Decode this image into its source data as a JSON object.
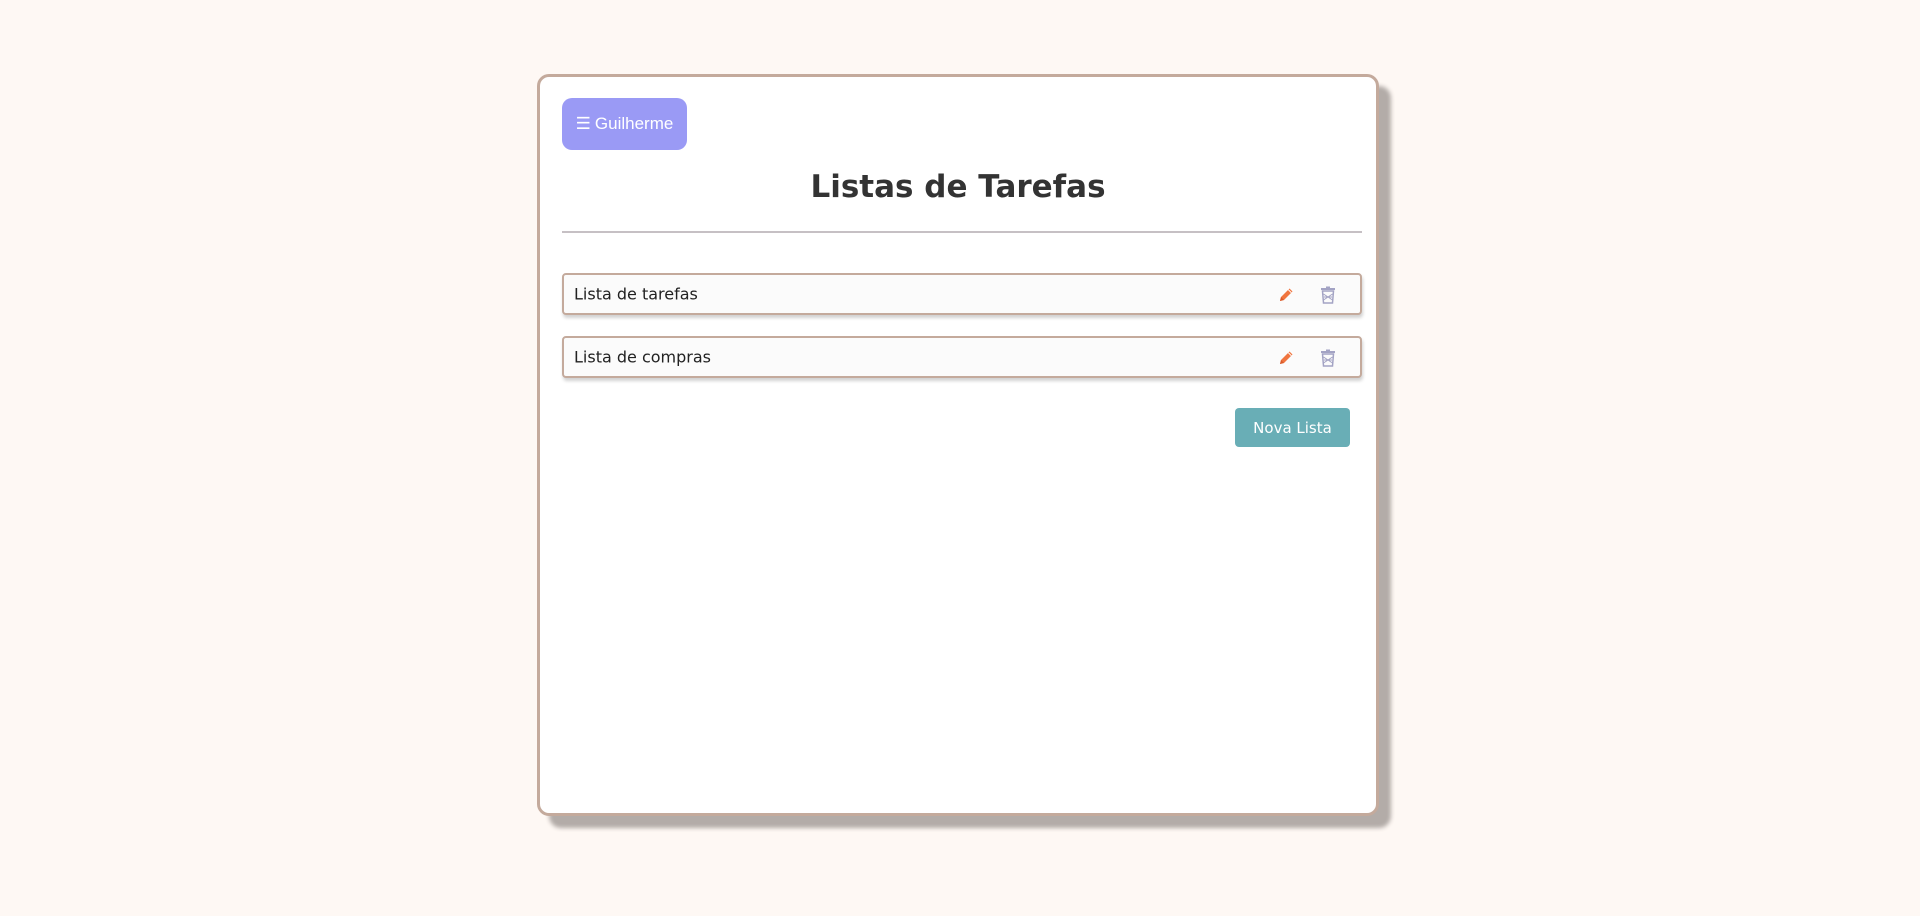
{
  "header": {
    "menu_glyph": "☰",
    "user_name": "Guilherme",
    "title": "Listas de Tarefas"
  },
  "lists": [
    {
      "label": "Lista de tarefas"
    },
    {
      "label": "Lista de compras"
    }
  ],
  "actions": {
    "new_list_label": "Nova Lista"
  },
  "icons": {
    "edit": "pencil-icon",
    "delete": "trash-icon"
  },
  "colors": {
    "background": "#fef8f4",
    "card_border": "#c4aa9c",
    "user_button": "#9a9af5",
    "new_list_button": "#69aeb6",
    "edit_icon": "#f0753f",
    "delete_icon": "#a3a3c4"
  }
}
